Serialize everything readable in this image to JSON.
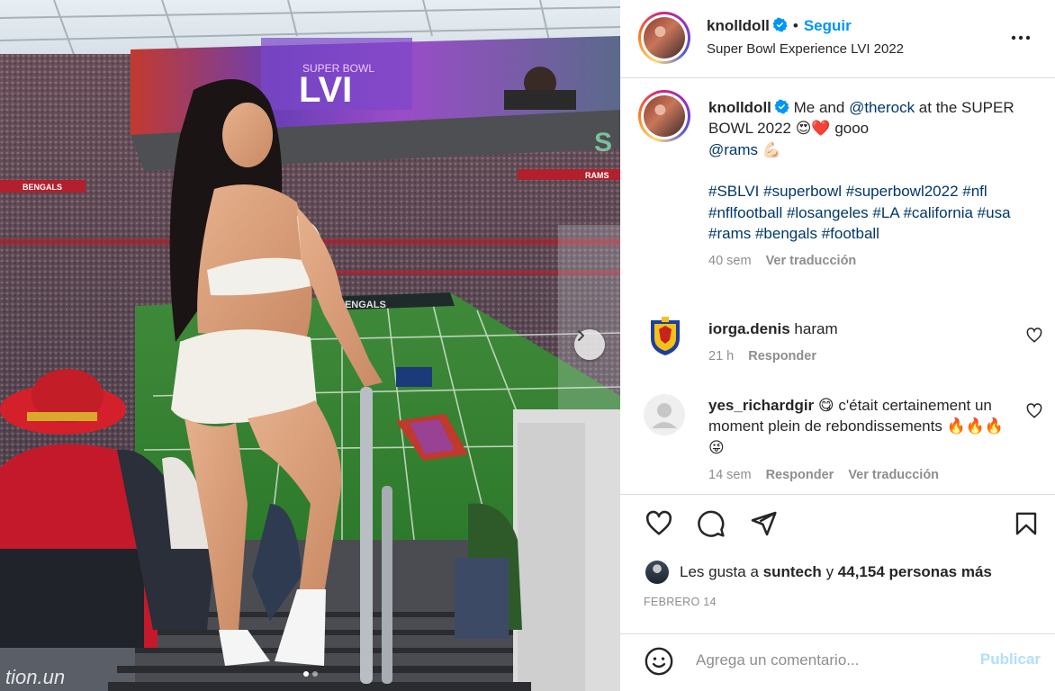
{
  "post": {
    "username": "knolldoll",
    "follow_label": "Seguir",
    "separator": "•",
    "location": "Super Bowl Experience LVI 2022",
    "more_icon": "more-horizontal-icon"
  },
  "caption": {
    "username": "knolldoll",
    "text_before": "Me and ",
    "mention_1": "@therock",
    "text_after": " at the SUPER BOWL 2022 ",
    "emojis_1": "😍❤️",
    "text_gooo": " gooo ",
    "mention_2": "@rams",
    "emoji_2": " 💪🏻",
    "hashtags": "#SBLVI #superbowl #superbowl2022 #nfl #nflfootball #losangeles #LA #california #usa #rams #bengals #football",
    "age": "40 sem",
    "translate": "Ver traducción"
  },
  "comments": [
    {
      "username": "iorga.denis",
      "text": "haram",
      "age": "21 h",
      "reply": "Responder"
    },
    {
      "username": "yes_richardgir",
      "text": "😋 c'était certainement un moment plein de rebondissements 🔥🔥🔥😜",
      "age": "14 sem",
      "reply": "Responder",
      "translate": "Ver traducción"
    }
  ],
  "likes": {
    "prefix": "Les gusta a ",
    "user": "suntech",
    "middle": " y ",
    "count": "44,154 personas más"
  },
  "date": "FEBRERO 14",
  "add_comment": {
    "placeholder": "Agrega un comentario...",
    "publish": "Publicar"
  },
  "photo": {
    "scoreboard_text_1": "SUPER BOWL",
    "scoreboard_text_2": "LVI",
    "stadium_sign": "S",
    "banner_left": "BENGALS",
    "banner_right": "RAMS",
    "endzone": "BENGALS",
    "watermark": "tion.un"
  },
  "colors": {
    "accent": "#0095f6",
    "link": "#00376b",
    "muted": "#8e8e8e",
    "divider": "#dbdbdb",
    "publish_disabled": "#b2dffc"
  }
}
